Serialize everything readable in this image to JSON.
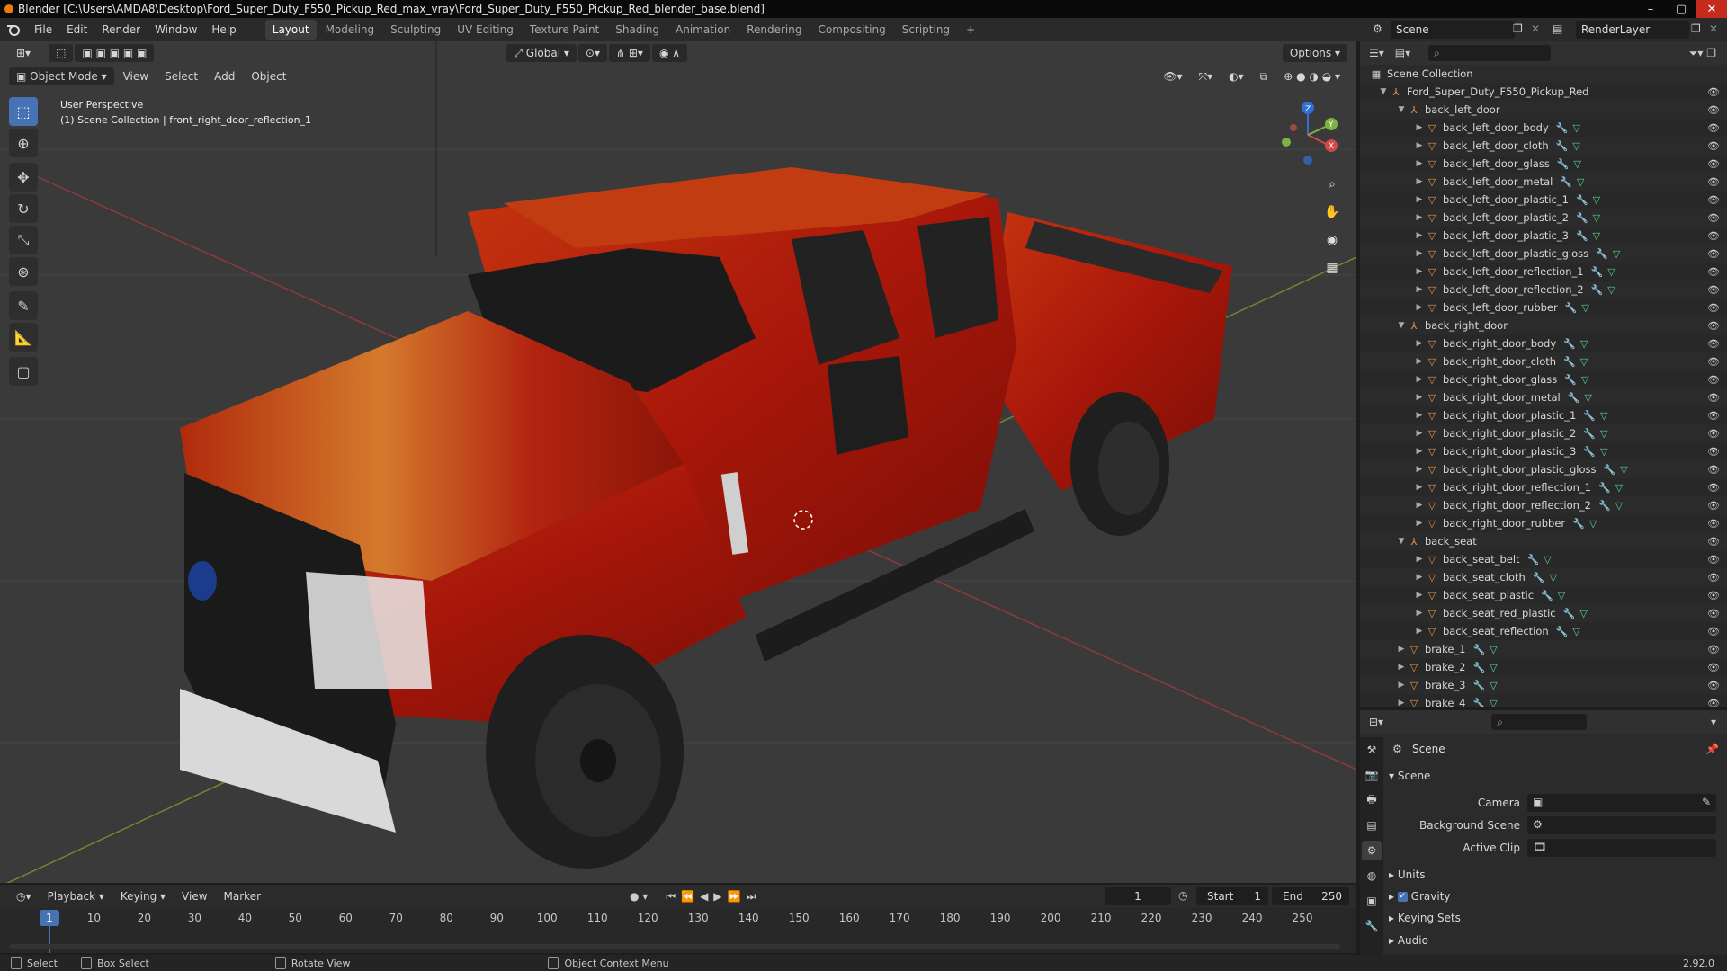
{
  "titlebar": {
    "title": "Blender [C:\\Users\\AMDA8\\Desktop\\Ford_Super_Duty_F550_Pickup_Red_max_vray\\Ford_Super_Duty_F550_Pickup_Red_blender_base.blend]",
    "minimize": "–",
    "maximize": "▢",
    "close": "✕"
  },
  "menu": [
    "File",
    "Edit",
    "Render",
    "Window",
    "Help"
  ],
  "workspaces": [
    "Layout",
    "Modeling",
    "Sculpting",
    "UV Editing",
    "Texture Paint",
    "Shading",
    "Animation",
    "Rendering",
    "Compositing",
    "Scripting"
  ],
  "workspace_add": "+",
  "scene_name": "Scene",
  "render_layer": "RenderLayer",
  "viewport": {
    "transform_orientation": "Global",
    "options_label": "Options",
    "mode": "Object Mode",
    "menus": [
      "View",
      "Select",
      "Add",
      "Object"
    ],
    "perspective": "User Perspective",
    "context": "(1) Scene Collection | front_right_door_reflection_1",
    "axis_x": "X",
    "axis_y": "Y",
    "axis_z": "Z"
  },
  "tools": [
    "select-box-icon",
    "cursor-icon",
    "move-icon",
    "rotate-icon",
    "scale-icon",
    "transform-icon",
    "annotate-icon",
    "measure-icon",
    "add-cube-icon"
  ],
  "outliner": {
    "root": "Scene Collection",
    "rows": [
      {
        "label": "Ford_Super_Duty_F550_Pickup_Red",
        "depth": 1,
        "type": "empty",
        "expanded": true
      },
      {
        "label": "back_left_door",
        "depth": 2,
        "type": "empty",
        "expanded": true
      },
      {
        "label": "back_left_door_body",
        "depth": 3,
        "type": "mesh"
      },
      {
        "label": "back_left_door_cloth",
        "depth": 3,
        "type": "mesh"
      },
      {
        "label": "back_left_door_glass",
        "depth": 3,
        "type": "mesh"
      },
      {
        "label": "back_left_door_metal",
        "depth": 3,
        "type": "mesh"
      },
      {
        "label": "back_left_door_plastic_1",
        "depth": 3,
        "type": "mesh"
      },
      {
        "label": "back_left_door_plastic_2",
        "depth": 3,
        "type": "mesh"
      },
      {
        "label": "back_left_door_plastic_3",
        "depth": 3,
        "type": "mesh"
      },
      {
        "label": "back_left_door_plastic_gloss",
        "depth": 3,
        "type": "mesh"
      },
      {
        "label": "back_left_door_reflection_1",
        "depth": 3,
        "type": "mesh"
      },
      {
        "label": "back_left_door_reflection_2",
        "depth": 3,
        "type": "mesh"
      },
      {
        "label": "back_left_door_rubber",
        "depth": 3,
        "type": "mesh"
      },
      {
        "label": "back_right_door",
        "depth": 2,
        "type": "empty",
        "expanded": true
      },
      {
        "label": "back_right_door_body",
        "depth": 3,
        "type": "mesh"
      },
      {
        "label": "back_right_door_cloth",
        "depth": 3,
        "type": "mesh"
      },
      {
        "label": "back_right_door_glass",
        "depth": 3,
        "type": "mesh"
      },
      {
        "label": "back_right_door_metal",
        "depth": 3,
        "type": "mesh"
      },
      {
        "label": "back_right_door_plastic_1",
        "depth": 3,
        "type": "mesh"
      },
      {
        "label": "back_right_door_plastic_2",
        "depth": 3,
        "type": "mesh"
      },
      {
        "label": "back_right_door_plastic_3",
        "depth": 3,
        "type": "mesh"
      },
      {
        "label": "back_right_door_plastic_gloss",
        "depth": 3,
        "type": "mesh"
      },
      {
        "label": "back_right_door_reflection_1",
        "depth": 3,
        "type": "mesh"
      },
      {
        "label": "back_right_door_reflection_2",
        "depth": 3,
        "type": "mesh"
      },
      {
        "label": "back_right_door_rubber",
        "depth": 3,
        "type": "mesh"
      },
      {
        "label": "back_seat",
        "depth": 2,
        "type": "empty",
        "expanded": true
      },
      {
        "label": "back_seat_belt",
        "depth": 3,
        "type": "mesh"
      },
      {
        "label": "back_seat_cloth",
        "depth": 3,
        "type": "mesh"
      },
      {
        "label": "back_seat_plastic",
        "depth": 3,
        "type": "mesh"
      },
      {
        "label": "back_seat_red_plastic",
        "depth": 3,
        "type": "mesh"
      },
      {
        "label": "back_seat_reflection",
        "depth": 3,
        "type": "mesh"
      },
      {
        "label": "brake_1",
        "depth": 2,
        "type": "mesh"
      },
      {
        "label": "brake_2",
        "depth": 2,
        "type": "mesh"
      },
      {
        "label": "brake_3",
        "depth": 2,
        "type": "mesh"
      },
      {
        "label": "brake_4",
        "depth": 2,
        "type": "mesh"
      }
    ]
  },
  "properties": {
    "context": "Scene",
    "panel": "Scene",
    "camera_label": "Camera",
    "background_scene_label": "Background Scene",
    "active_clip_label": "Active Clip",
    "subpanels": [
      "Units",
      "Gravity",
      "Keying Sets",
      "Audio"
    ],
    "gravity_checked": true,
    "version": "2.92.0"
  },
  "timeline": {
    "menus": [
      "Playback",
      "Keying",
      "View",
      "Marker"
    ],
    "current_frame": "1",
    "start_label": "Start",
    "start": "1",
    "end_label": "End",
    "end": "250",
    "ticks": [
      "10",
      "20",
      "30",
      "40",
      "50",
      "60",
      "70",
      "80",
      "90",
      "100",
      "110",
      "120",
      "130",
      "140",
      "150",
      "160",
      "170",
      "180",
      "190",
      "200",
      "210",
      "220",
      "230",
      "240",
      "250"
    ],
    "playhead": "1"
  },
  "statusbar": {
    "select": "Select",
    "box_select": "Box Select",
    "rotate_view": "Rotate View",
    "context_menu": "Object Context Menu"
  },
  "colors": {
    "accent": "#4772b3",
    "truck_red": "#b0200c",
    "mesh_icon": "#e8944a",
    "modifier_icon": "#6ab7ff",
    "data_icon": "#58d68d"
  }
}
